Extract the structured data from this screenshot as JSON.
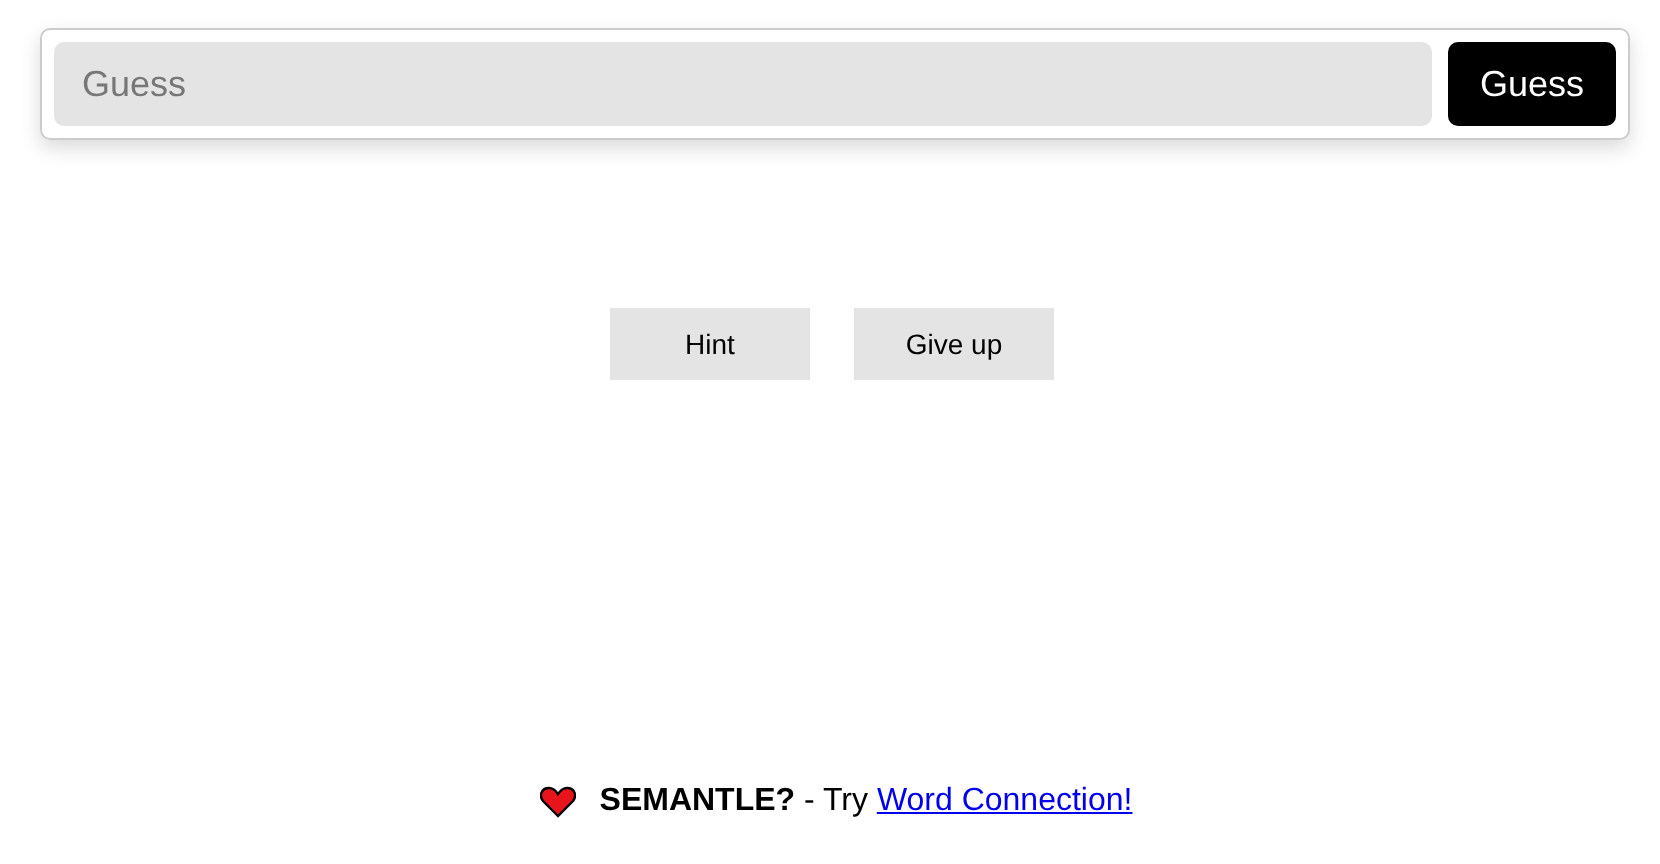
{
  "guess_form": {
    "placeholder": "Guess",
    "button": "Guess"
  },
  "actions": [
    {
      "label": "Hint"
    },
    {
      "label": "Give up"
    }
  ],
  "footer": {
    "text": "**SEMANTLE?** - Try ",
    "link": "Word Connection!"
  }
}
